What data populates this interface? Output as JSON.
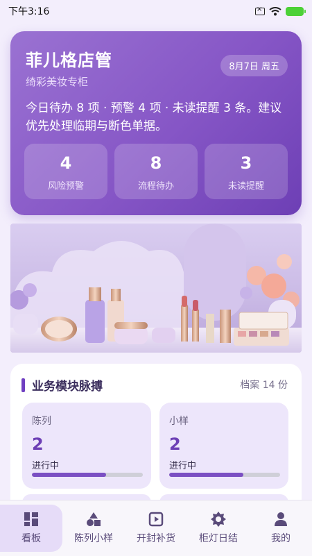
{
  "status_bar": {
    "time": "下午3:16",
    "battery_icon": "battery-charging-icon"
  },
  "hero": {
    "title": "菲儿格店管",
    "subtitle": "绮彩美妆专柜",
    "date": "8月7日 周五",
    "summary": "今日待办 8 项 · 预警 4 项 · 未读提醒 3 条。建议优先处理临期与断色单据。",
    "stats": [
      {
        "value": "4",
        "label": "风险预警"
      },
      {
        "value": "8",
        "label": "流程待办"
      },
      {
        "value": "3",
        "label": "未读提醒"
      }
    ]
  },
  "banner": {
    "image": "cosmetics-product-display-image"
  },
  "modules_section": {
    "title": "业务模块脉搏",
    "count": "档案 14 份",
    "modules": [
      {
        "name": "陈列",
        "value": "2",
        "status": "进行中",
        "progress": 0.67
      },
      {
        "name": "小样",
        "value": "2",
        "status": "进行中",
        "progress": 0.67
      }
    ]
  },
  "bottom_nav": {
    "items": [
      {
        "label": "看板",
        "icon": "dashboard-grid-icon",
        "active": true
      },
      {
        "label": "陈列小样",
        "icon": "shapes-icon",
        "active": false
      },
      {
        "label": "开封补货",
        "icon": "play-box-icon",
        "active": false
      },
      {
        "label": "柜灯日结",
        "icon": "gear-icon",
        "active": false
      },
      {
        "label": "我的",
        "icon": "person-icon",
        "active": false
      }
    ]
  },
  "colors": {
    "accent": "#7b4fc3",
    "hero_start": "#9a72d2",
    "hero_end": "#6d3fb5",
    "page_bg": "#f3eefc"
  }
}
